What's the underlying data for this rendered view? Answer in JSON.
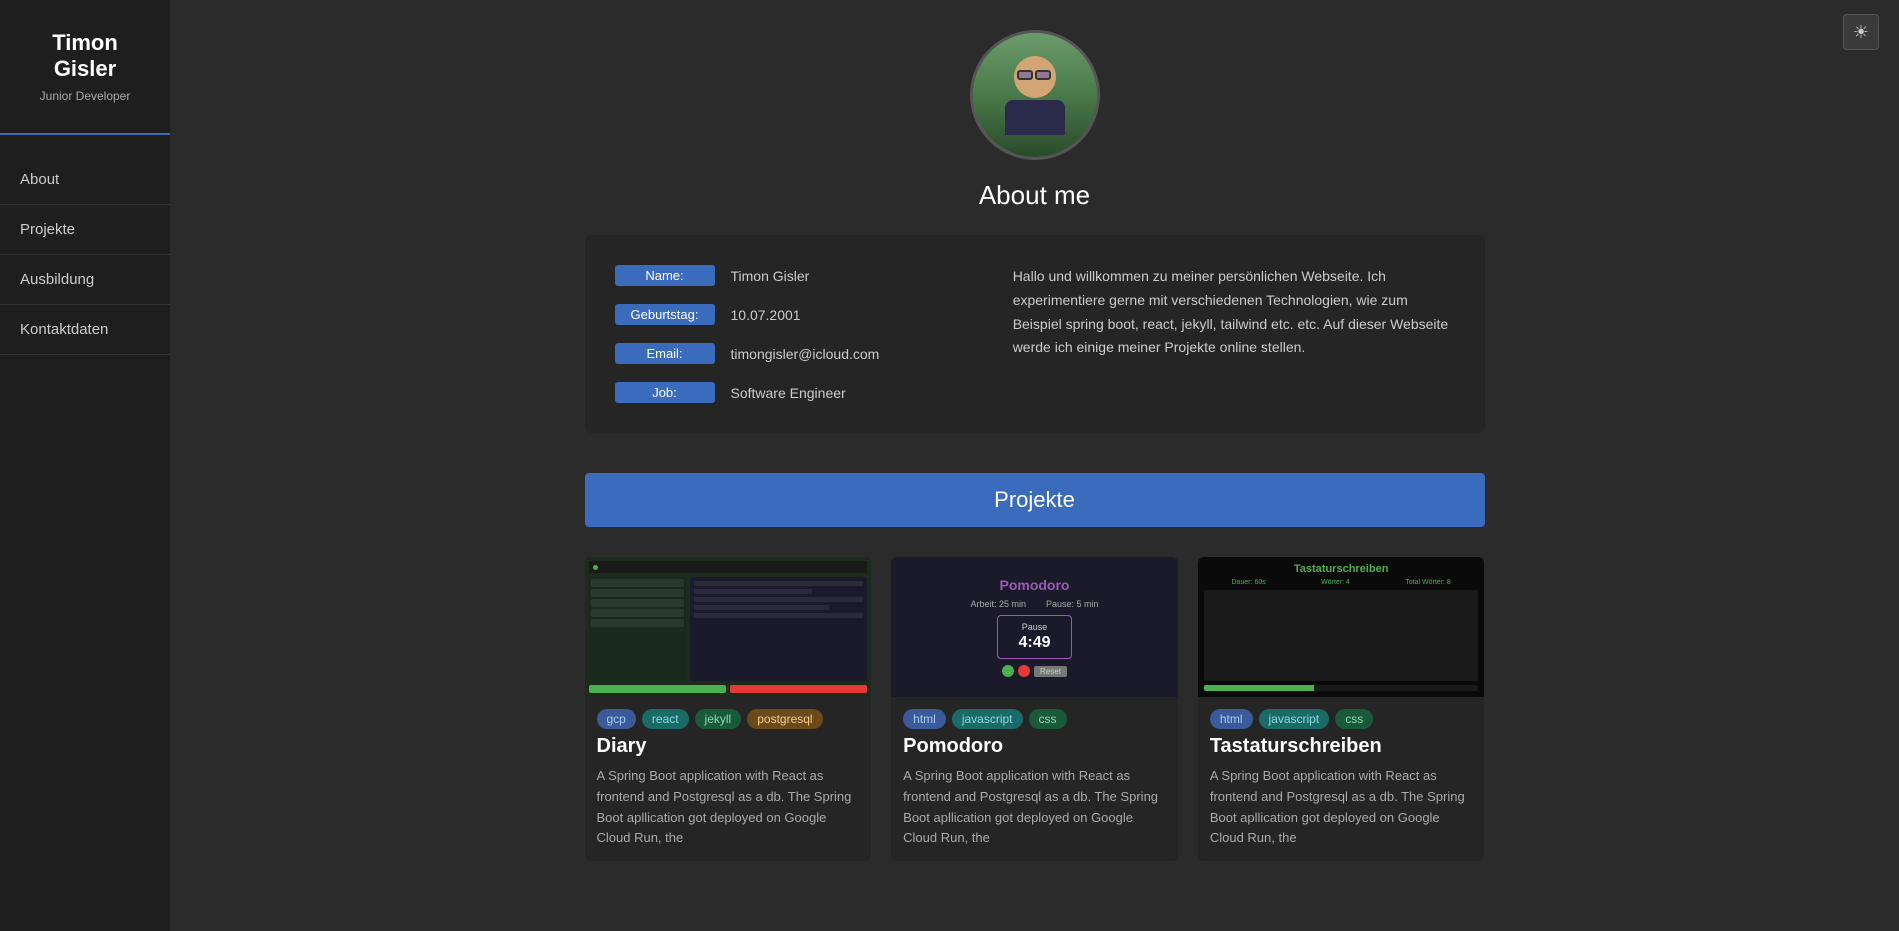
{
  "sidebar": {
    "name_line1": "Timon",
    "name_line2": "Gisler",
    "subtitle": "Junior Developer",
    "nav_items": [
      {
        "label": "About",
        "id": "about"
      },
      {
        "label": "Projekte",
        "id": "projekte"
      },
      {
        "label": "Ausbildung",
        "id": "ausbildung"
      },
      {
        "label": "Kontaktdaten",
        "id": "kontaktdaten"
      }
    ]
  },
  "theme_toggle": {
    "icon": "☀"
  },
  "about": {
    "title": "About me",
    "info": {
      "name_label": "Name:",
      "name_value": "Timon Gisler",
      "birthday_label": "Geburtstag:",
      "birthday_value": "10.07.2001",
      "email_label": "Email:",
      "email_value": "timongisler@icloud.com",
      "job_label": "Job:",
      "job_value": "Software Engineer"
    },
    "description": "Hallo und willkommen zu meiner persönlichen Webseite. Ich experimentiere gerne mit verschiedenen Technologien, wie zum Beispiel spring boot, react, jekyll, tailwind etc. etc. Auf dieser Webseite werde ich einige meiner Projekte online stellen."
  },
  "projekte": {
    "header": "Projekte",
    "projects": [
      {
        "name": "Diary",
        "tags": [
          "gcp",
          "react",
          "jekyll",
          "postgresql"
        ],
        "tag_colors": [
          "blue",
          "teal",
          "green",
          "orange"
        ],
        "description": "A Spring Boot application with React as frontend and Postgresql as a db. The Spring Boot apllication got deployed on Google Cloud Run, the"
      },
      {
        "name": "Pomodoro",
        "tags": [
          "html",
          "javascript",
          "css"
        ],
        "tag_colors": [
          "blue",
          "teal",
          "green"
        ],
        "description": "A Spring Boot application with React as frontend and Postgresql as a db. The Spring Boot apllication got deployed on Google Cloud Run, the"
      },
      {
        "name": "Tastaturschreiben",
        "tags": [
          "html",
          "javascript",
          "css"
        ],
        "tag_colors": [
          "blue",
          "teal",
          "green"
        ],
        "description": "A Spring Boot application with React as frontend and Postgresql as a db. The Spring Boot apllication got deployed on Google Cloud Run, the"
      }
    ]
  }
}
